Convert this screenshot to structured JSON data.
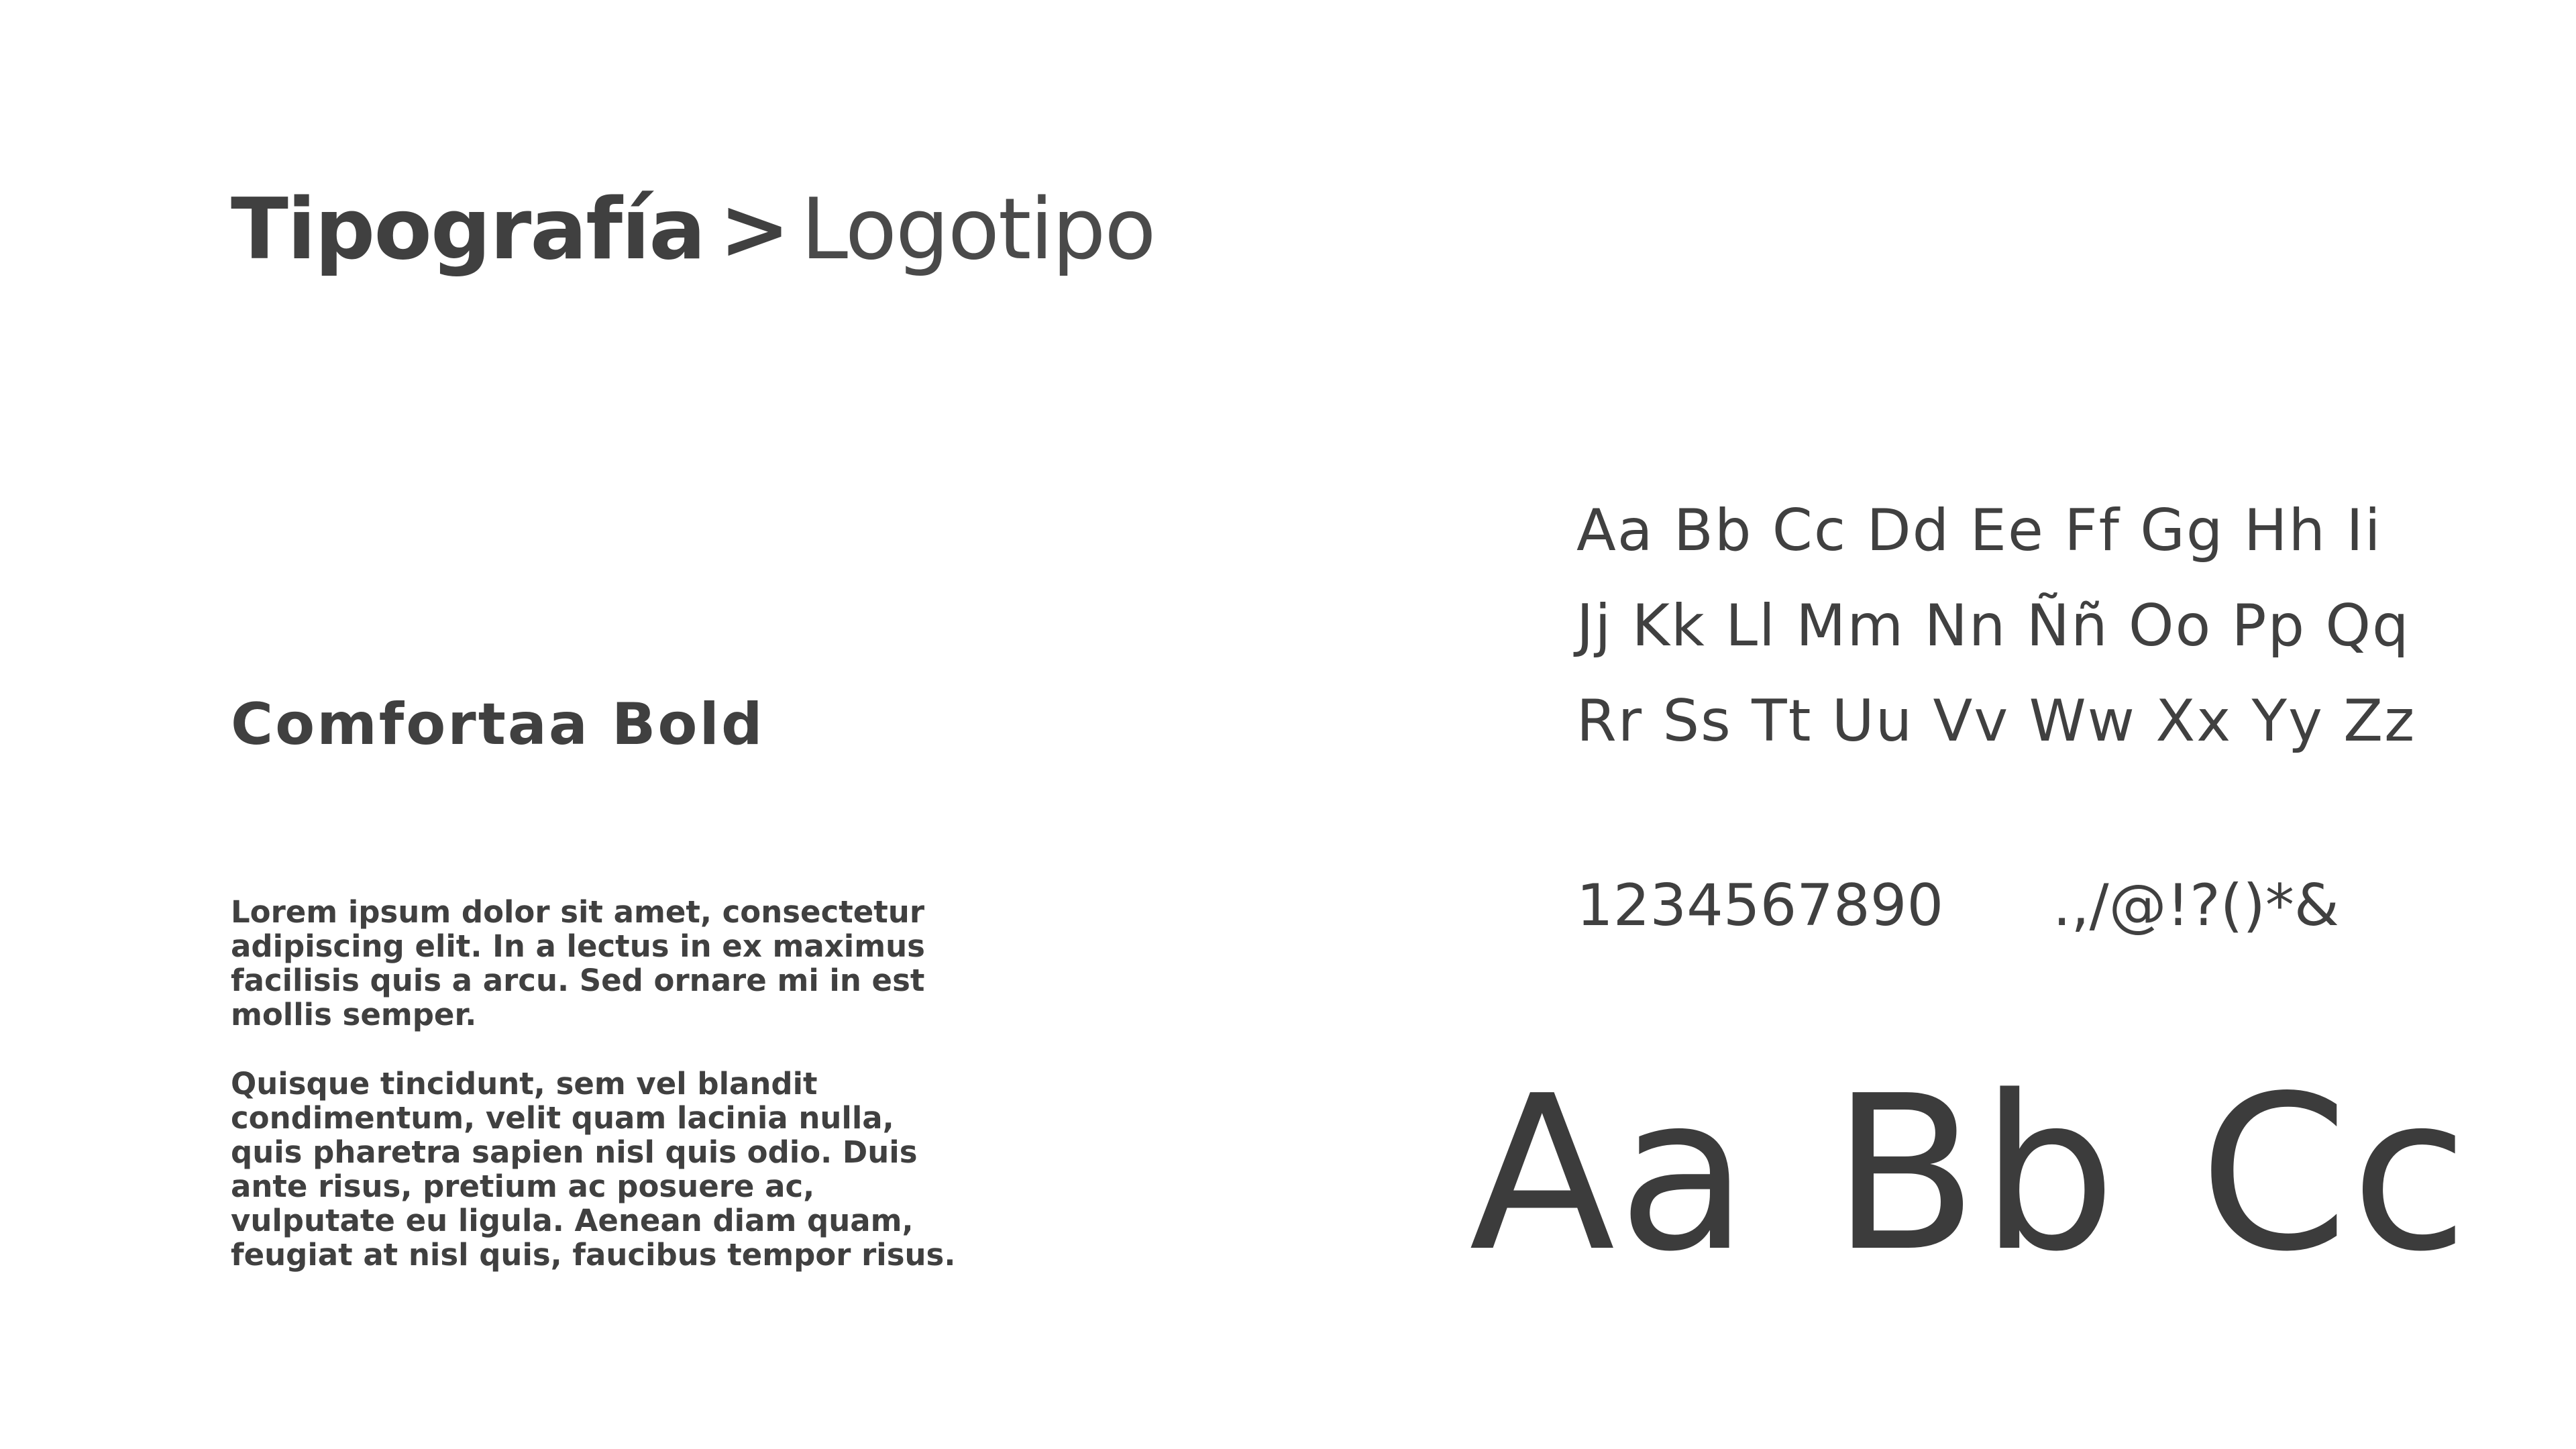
{
  "heading": {
    "section": "Tipografía",
    "separator": ">",
    "subsection": "Logotipo"
  },
  "font": {
    "name": "Comfortaa Bold"
  },
  "description": {
    "paragraph_1": "Lorem ipsum dolor sit amet, consectetur adipiscing elit. In a lectus in ex maximus facilisis quis a arcu. Sed ornare mi in est mollis semper.",
    "paragraph_2": "Quisque tincidunt, sem vel blandit condimentum, velit quam lacinia nulla, quis pharetra sapien nisl quis odio. Duis ante risus, pretium ac posuere ac, vulputate eu ligula. Aenean diam quam, feugiat at nisl quis, faucibus tempor risus."
  },
  "alphabet": {
    "line_1": "Aa Bb Cc Dd Ee Ff Gg Hh Ii",
    "line_2": "Jj Kk Ll Mm Nn Ññ Oo Pp Qq",
    "line_3": "Rr Ss Tt Uu Vv Ww Xx Yy Zz"
  },
  "numerals": "1234567890",
  "symbols": ".,/@!?()*&",
  "large_sample": [
    "Aa",
    "Bb",
    "Cc"
  ]
}
